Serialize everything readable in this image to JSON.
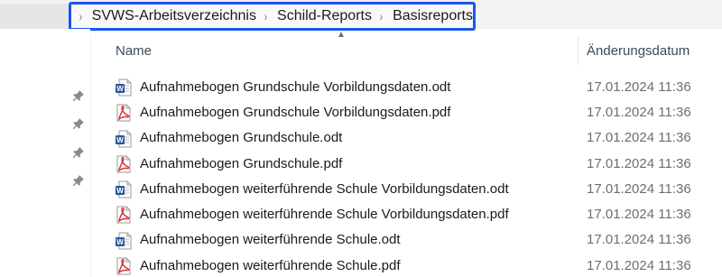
{
  "breadcrumb": {
    "items": [
      "SVWS-Arbeitsverzeichnis",
      "Schild-Reports",
      "Basisreports"
    ],
    "separator": "›"
  },
  "columns": {
    "name": "Name",
    "date": "Änderungsdatum"
  },
  "files": [
    {
      "name": "Aufnahmebogen Grundschule Vorbildungsdaten.odt",
      "type": "odt",
      "icon": "word-document-icon",
      "date": "17.01.2024 11:36"
    },
    {
      "name": "Aufnahmebogen Grundschule Vorbildungsdaten.pdf",
      "type": "pdf",
      "icon": "pdf-document-icon",
      "date": "17.01.2024 11:36"
    },
    {
      "name": "Aufnahmebogen Grundschule.odt",
      "type": "odt",
      "icon": "word-document-icon",
      "date": "17.01.2024 11:36"
    },
    {
      "name": "Aufnahmebogen Grundschule.pdf",
      "type": "pdf",
      "icon": "pdf-document-icon",
      "date": "17.01.2024 11:36"
    },
    {
      "name": "Aufnahmebogen weiterführende Schule Vorbildungsdaten.odt",
      "type": "odt",
      "icon": "word-document-icon",
      "date": "17.01.2024 11:36"
    },
    {
      "name": "Aufnahmebogen weiterführende Schule Vorbildungsdaten.pdf",
      "type": "pdf",
      "icon": "pdf-document-icon",
      "date": "17.01.2024 11:36"
    },
    {
      "name": "Aufnahmebogen weiterführende Schule.odt",
      "type": "odt",
      "icon": "word-document-icon",
      "date": "17.01.2024 11:36"
    },
    {
      "name": "Aufnahmebogen weiterführende Schule.pdf",
      "type": "pdf",
      "icon": "pdf-document-icon",
      "date": "17.01.2024 11:36"
    }
  ],
  "colors": {
    "highlight_border": "#1a56f0",
    "word_blue": "#2b579a",
    "pdf_red": "#d32f2f"
  }
}
